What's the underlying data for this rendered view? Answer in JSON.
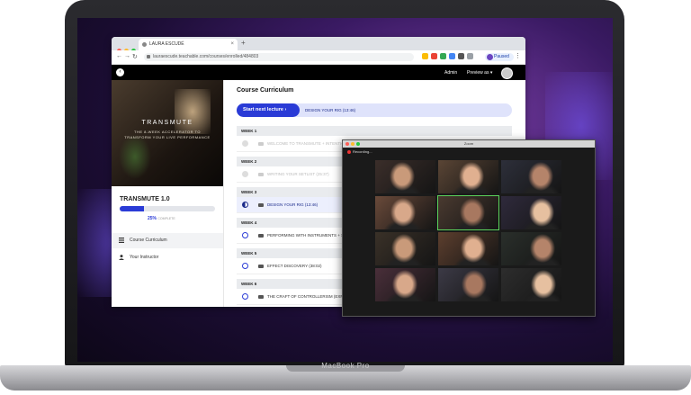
{
  "device": {
    "label": "MacBook Pro"
  },
  "browser": {
    "tab_title": "LAURA ESCUDÉ",
    "new_tab": "+",
    "close": "×",
    "url": "lauraescude.teachable.com/courses/enrolled/484803",
    "profile_status": "Paused",
    "menu": "⋮",
    "back": "←",
    "forward": "→",
    "reload": "↻"
  },
  "site_header": {
    "back_icon": "‹",
    "admin": "Admin",
    "preview": "Preview as ▾"
  },
  "sidebar": {
    "cover_title": "TRANSMUTE",
    "cover_subtitle": "THE 8-WEEK ACCELERATOR TO TRANSFORM YOUR LIVE PERFORMANCE",
    "course_title": "TRANSMUTE 1.0",
    "progress_percent": 25,
    "progress_value": "25%",
    "progress_suffix": "COMPLETE",
    "items": [
      {
        "label": "Course Curriculum",
        "icon": "list-icon",
        "active": true
      },
      {
        "label": "Your Instructor",
        "icon": "person-icon",
        "active": false
      }
    ]
  },
  "main": {
    "title": "Course Curriculum",
    "next_button": "Start next lecture  ›",
    "next_label": "DESIGN YOUR RIG (13:46)",
    "weeks": [
      {
        "label": "WEEK 1",
        "lecture": "WELCOME TO TRANSMUTE + INTENTIONS",
        "state": "done"
      },
      {
        "label": "WEEK 2",
        "lecture": "WRITING YOUR SETLIST (25:37)",
        "state": "done"
      },
      {
        "label": "WEEK 3",
        "lecture": "DESIGN YOUR RIG (13:46)",
        "state": "current"
      },
      {
        "label": "WEEK 4",
        "lecture": "PERFORMING WITH INSTRUMENTS + SAMPLES",
        "state": "todo"
      },
      {
        "label": "WEEK 5",
        "lecture": "EFFECT DISCOVERY (38:02)",
        "state": "todo"
      },
      {
        "label": "WEEK 6",
        "lecture": "THE CRAFT OF CONTROLLERISM (EXPLORE YOUR)",
        "state": "todo"
      }
    ]
  },
  "zoom": {
    "window_title": "Zoom",
    "recording": "Recording...",
    "participants": 12
  },
  "colors": {
    "accent": "#2a3bd6",
    "zoom_active": "#5bd35b"
  }
}
